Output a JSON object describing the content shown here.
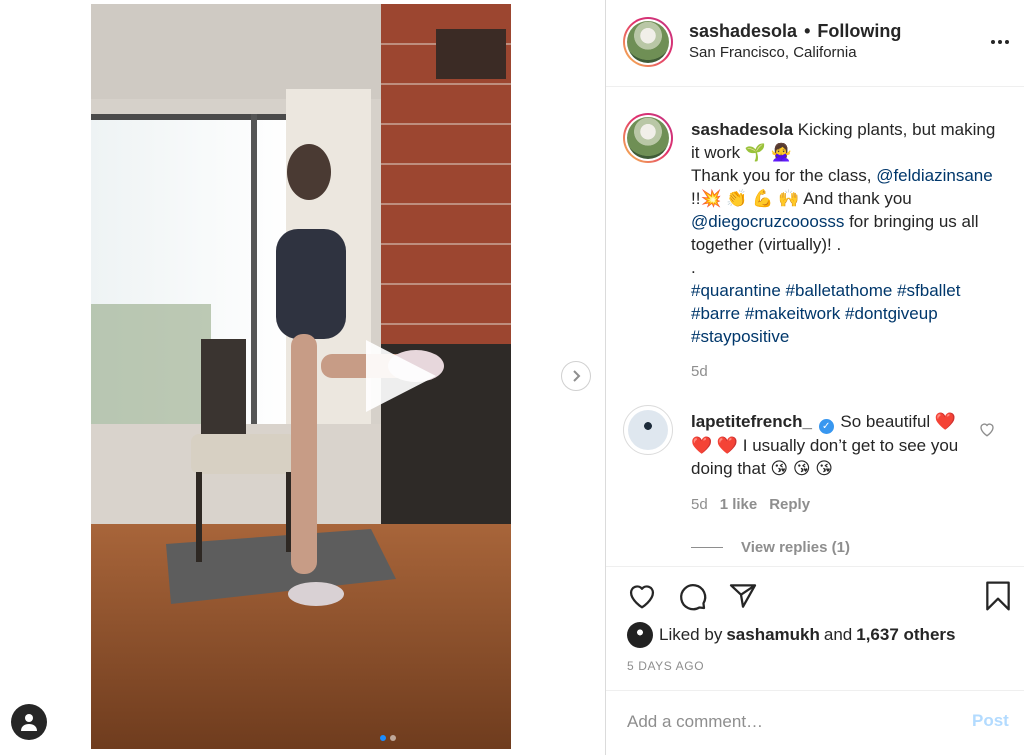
{
  "header": {
    "username": "sashadesola",
    "separator": "•",
    "follow_status": "Following",
    "location": "San Francisco, California"
  },
  "caption": {
    "username": "sashadesola",
    "line1": " Kicking plants, but making it work 🌱 🙅‍♀️",
    "line2": "Thank you for the class, ",
    "mention1": "@feldiazinsane",
    "line3": " !!💥 👏 💪 🙌  And thank you ",
    "mention2": "@diegocruzcooosss",
    "line4": " for bringing us all together (virtually)! .",
    "line5": ".",
    "hashtags": [
      "#quarantine",
      "#balletathome",
      "#sfballet",
      "#barre",
      "#makeitwork",
      "#dontgiveup",
      "#staypositive"
    ],
    "time_ago": "5d"
  },
  "comment": {
    "username": "lapetitefrench_",
    "verified_glyph": "✓",
    "text": " So beautiful ❤️ ❤️ ❤️  I usually don’t get to see you doing that 😘 😘 😘",
    "time_ago": "5d",
    "likes": "1 like",
    "reply": "Reply",
    "view_replies": "View replies (1)"
  },
  "likes": {
    "prefix": "Liked by",
    "user": "sashamukh",
    "middle": "and",
    "others": "1,637 others"
  },
  "date": "5 DAYS AGO",
  "add_comment": {
    "placeholder": "Add a comment…",
    "post_label": "Post"
  },
  "carousel": {
    "total": 2,
    "active_index": 0
  },
  "colors": {
    "link": "#00376b",
    "muted": "#8e8e8e",
    "post_disabled": "#b3dbff",
    "active_dot": "#1a8cff",
    "verified": "#3897f0"
  },
  "icons": [
    "more-icon",
    "play-icon",
    "chevron-right-icon",
    "heart-icon",
    "comment-icon",
    "share-icon",
    "bookmark-icon",
    "user-icon"
  ]
}
